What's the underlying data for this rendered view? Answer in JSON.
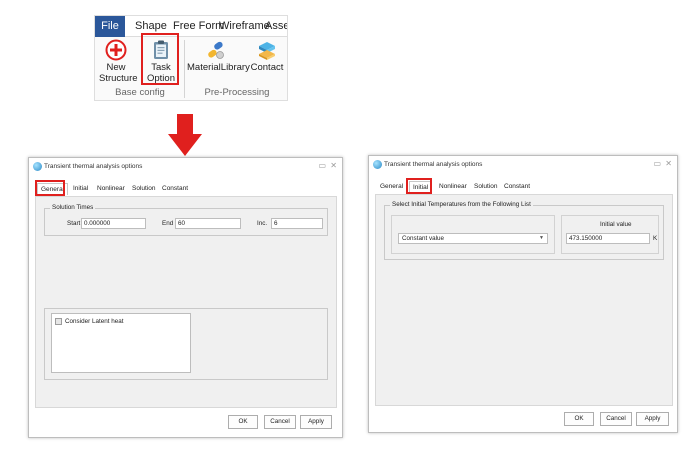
{
  "ribbon": {
    "tabs": [
      "File",
      "Shape",
      "Free Form",
      "Wireframe",
      "Assem"
    ],
    "buttons": {
      "new_structure": [
        "New",
        "Structure"
      ],
      "task_option": [
        "Task",
        "Option"
      ],
      "material_library": "MaterialLibrary",
      "contact": "Contact"
    },
    "groups": {
      "base_config": "Base config",
      "pre_processing": "Pre-Processing"
    }
  },
  "colors": {
    "highlight": "#e0201e",
    "file_tab": "#2b579a",
    "arrow": "#e0201e"
  },
  "dialog_left": {
    "title": "Transient thermal analysis options",
    "tabs": [
      "General",
      "Initial",
      "Nonlinear",
      "Solution",
      "Constant"
    ],
    "active_tab": "General",
    "solution_times": {
      "title": "Solution Times",
      "start_label": "Start",
      "start_value": "0.000000",
      "end_label": "End",
      "end_value": "60",
      "inc_label": "Inc.",
      "inc_value": "6"
    },
    "latent_heat_label": "Consider Latent heat",
    "buttons": {
      "ok": "OK",
      "cancel": "Cancel",
      "apply": "Apply"
    }
  },
  "dialog_right": {
    "title": "Transient thermal analysis options",
    "tabs": [
      "General",
      "Initial",
      "Nonlinear",
      "Solution",
      "Constant"
    ],
    "active_tab": "Initial",
    "group_title": "Select Initial Temperatures from the Following List",
    "select_value": "Constant value",
    "initial_value_header": "Initial value",
    "initial_value": "473.150000",
    "unit": "K",
    "buttons": {
      "ok": "OK",
      "cancel": "Cancel",
      "apply": "Apply"
    }
  },
  "icons": [
    "plus-circle-icon",
    "clipboard-icon",
    "material-library-icon",
    "contact-icon",
    "app-icon",
    "restore-icon",
    "close-icon",
    "dropdown-caret-icon",
    "down-arrow-icon"
  ]
}
